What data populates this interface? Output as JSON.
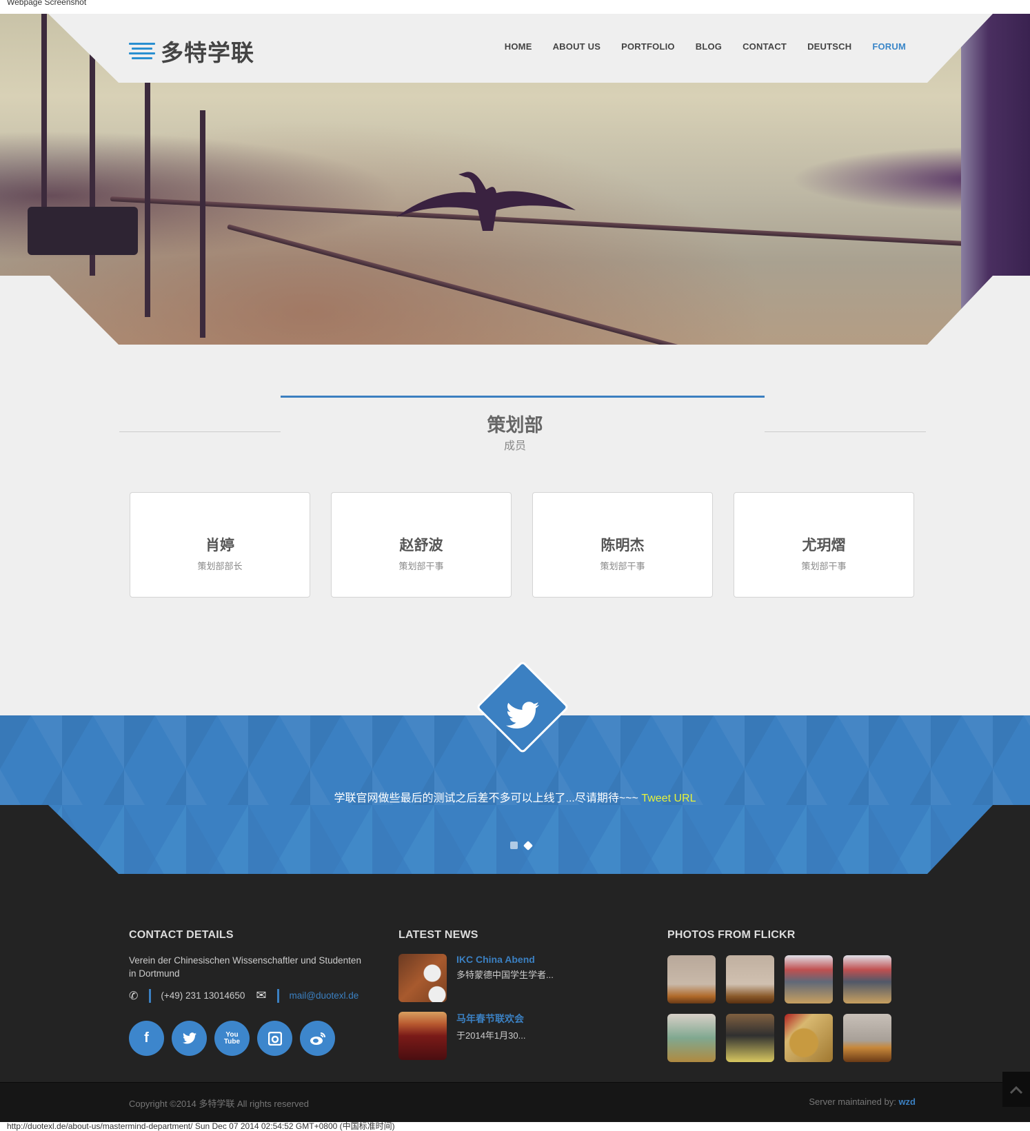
{
  "screenshot_caption": "Webpage Screenshot",
  "header": {
    "logo_text": "多特学联",
    "nav": [
      {
        "label": "HOME",
        "active": false
      },
      {
        "label": "ABOUT US",
        "active": false
      },
      {
        "label": "PORTFOLIO",
        "active": false
      },
      {
        "label": "BLOG",
        "active": false
      },
      {
        "label": "CONTACT",
        "active": false
      },
      {
        "label": "DEUTSCH",
        "active": false
      },
      {
        "label": "FORUM",
        "active": true
      }
    ]
  },
  "section": {
    "title": "策划部",
    "subtitle": "成员"
  },
  "members": [
    {
      "name": "肖婷",
      "role": "策划部部长"
    },
    {
      "name": "赵舒波",
      "role": "策划部干事"
    },
    {
      "name": "陈明杰",
      "role": "策划部干事"
    },
    {
      "name": "尤玥熠",
      "role": "策划部干事"
    }
  ],
  "twitter": {
    "icon": "twitter-bird-icon",
    "tweet_text": "学联官网做些最后的测试之后差不多可以上线了...尽请期待~~~ ",
    "tweet_link": "Tweet URL",
    "slides": 2,
    "active_slide": 2
  },
  "footer": {
    "contact": {
      "heading": "CONTACT DETAILS",
      "org": "Verein der Chinesischen Wissenschaftler und Studenten in Dortmund",
      "phone": "(+49) 231 13014650",
      "email": "mail@duotexl.de",
      "socials": [
        "facebook-icon",
        "twitter-icon",
        "youtube-icon",
        "instagram-icon",
        "weibo-icon"
      ]
    },
    "news": {
      "heading": "LATEST NEWS",
      "items": [
        {
          "title": "IKC China Abend",
          "excerpt": "多特蒙德中国学生学者..."
        },
        {
          "title": "马年春节联欢会",
          "excerpt": "于2014年1月30..."
        }
      ]
    },
    "flickr": {
      "heading": "PHOTOS FROM FLICKR",
      "photo_count": 8
    },
    "copyright": "Copyright ©2014 多特学联 All rights reserved",
    "maintained_label": "Server maintained by: ",
    "maintained_by": "wzd"
  },
  "status_bar": "http://duotexl.de/about-us/mastermind-department/ Sun Dec 07 2014 02:54:52 GMT+0800 (中国标准时间)",
  "colors": {
    "accent": "#3b80c2",
    "tweet_link": "#e6f23a",
    "footer_bg": "#232323"
  }
}
